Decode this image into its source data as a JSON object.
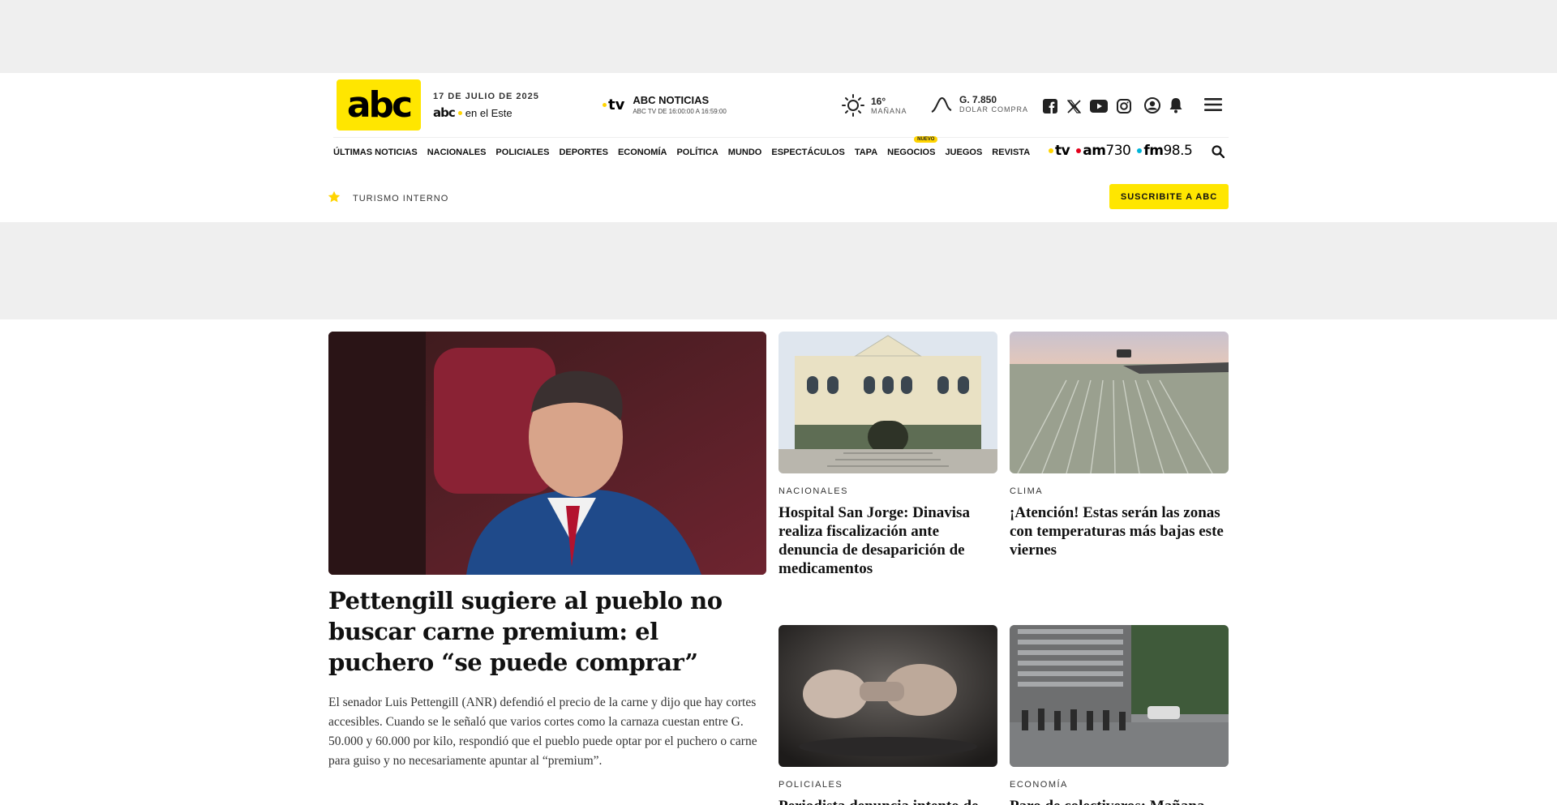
{
  "header": {
    "logo_text": "abc",
    "date": "17 DE JULIO DE 2025",
    "este_logo": "abc",
    "este_label": "en el Este",
    "tv_mark": "tv",
    "tv_title": "ABC NOTICIAS",
    "tv_schedule": "ABC TV DE 16:00:00 A 16:59:00",
    "weather_value": "16°",
    "weather_label": "MAÑANA",
    "dolar_value": "G. 7.850",
    "dolar_label": "DOLAR COMPRA",
    "social_icons": [
      "facebook-icon",
      "x-icon",
      "youtube-icon",
      "instagram-icon"
    ]
  },
  "nav": {
    "items": [
      "ÚLTIMAS NOTICIAS",
      "NACIONALES",
      "POLICIALES",
      "DEPORTES",
      "ECONOMÍA",
      "POLÍTICA",
      "MUNDO",
      "ESPECTÁCULOS",
      "TAPA",
      "NEGOCIOS",
      "JUEGOS",
      "REVISTA"
    ],
    "badge": "NUEVO",
    "radio_tv": "tv",
    "radio_am": "am",
    "radio_am_num": "730",
    "radio_fm": "fm",
    "radio_fm_num": "98.5"
  },
  "trending": {
    "label": "TURISMO INTERNO",
    "subscribe": "SUSCRIBITE A ABC"
  },
  "main_story": {
    "title": "Pettengill sugiere al pueblo no buscar carne premium: el puchero “se puede comprar”",
    "summary": "El senador Luis Pettengill (ANR) defendió el precio de la carne y dijo que hay cortes accesibles. Cuando se le señaló que varios cortes como la carnaza cuestan entre G. 50.000 y 60.000 por kilo, respondió que el pueblo puede optar por el puchero o carne para guiso y no necesariamente apuntar al “premium”."
  },
  "cards": [
    {
      "category": "NACIONALES",
      "title": "Hospital San Jorge: Dinavisa realiza fiscalización ante denuncia de desaparición de medicamentos"
    },
    {
      "category": "CLIMA",
      "title": "¡Atención! Estas serán las zonas con temperaturas más bajas este viernes"
    },
    {
      "category": "POLICIALES",
      "title": "Periodista denuncia intento de"
    },
    {
      "category": "ECONOMÍA",
      "title": "Paro de colectiveros: Mañana"
    }
  ],
  "colors": {
    "brand_yellow": "#ffe600",
    "accent_red": "#e3001b",
    "accent_cyan": "#00b4d8"
  }
}
